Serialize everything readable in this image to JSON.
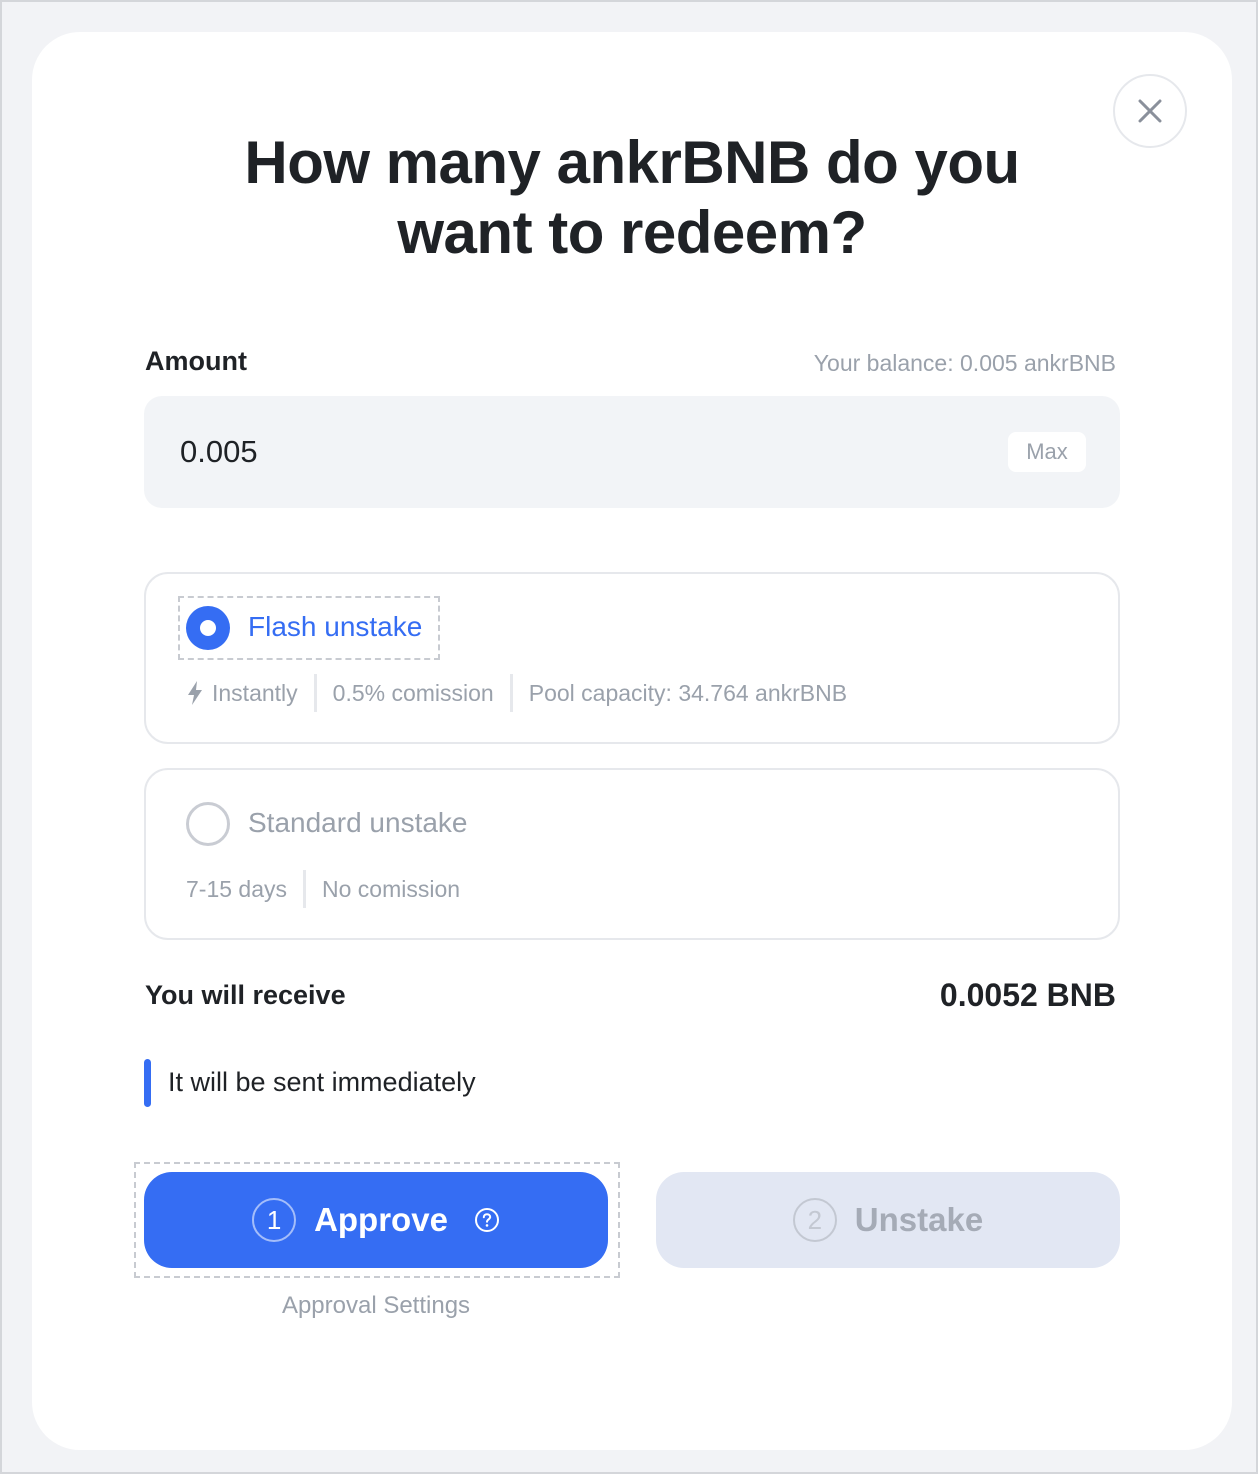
{
  "dialog": {
    "title": "How many ankrBNB do you want to redeem?",
    "close_icon": "close-icon"
  },
  "amount": {
    "label": "Amount",
    "balance": "Your balance: 0.005 ankrBNB",
    "value": "0.005",
    "max_label": "Max"
  },
  "options": {
    "flash": {
      "title": "Flash unstake",
      "selected": true,
      "icon": "lightning-icon",
      "meta": [
        "Instantly",
        "0.5% comission",
        "Pool capacity: 34.764 ankrBNB"
      ]
    },
    "standard": {
      "title": "Standard unstake",
      "selected": false,
      "meta": [
        "7-15 days",
        "No comission"
      ]
    }
  },
  "receive": {
    "label": "You will receive",
    "value": "0.0052 BNB"
  },
  "note": {
    "text": "It will be sent immediately"
  },
  "actions": {
    "approve": {
      "step": "1",
      "label": "Approve",
      "icon": "help-icon"
    },
    "unstake": {
      "step": "2",
      "label": "Unstake"
    },
    "approval_settings": "Approval Settings"
  },
  "colors": {
    "accent": "#356df3",
    "muted_text": "#9aa1ab",
    "primary_text": "#1f2226",
    "disabled_button": "#e2e7f3"
  }
}
